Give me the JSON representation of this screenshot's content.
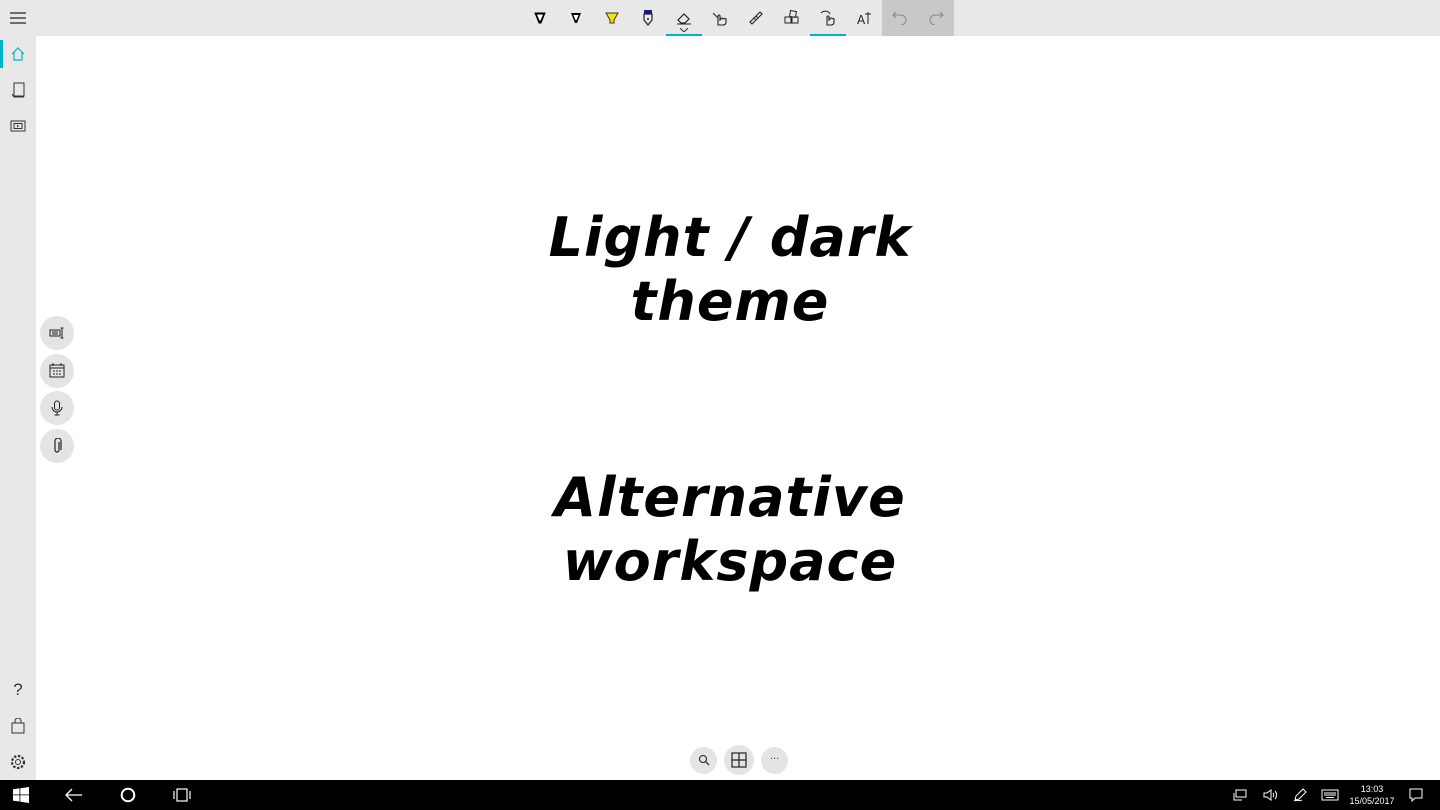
{
  "canvas": {
    "heading1": [
      "Light / dark",
      "theme"
    ],
    "heading2": [
      "Alternative",
      "workspace"
    ]
  },
  "toolbar": {
    "tools": [
      {
        "name": "ballpoint-pen-icon",
        "color": "#000000"
      },
      {
        "name": "pencil-tool-icon",
        "color": "#000000"
      },
      {
        "name": "highlighter-icon",
        "color": "#f2e600"
      },
      {
        "name": "fountain-pen-icon",
        "color": "#1a1a8c"
      },
      {
        "name": "eraser-icon",
        "active": true
      },
      {
        "name": "lasso-select-icon"
      },
      {
        "name": "ruler-icon"
      },
      {
        "name": "shapes-icon"
      },
      {
        "name": "touch-writing-icon",
        "active": true
      },
      {
        "name": "text-format-icon"
      },
      {
        "name": "undo-icon"
      },
      {
        "name": "redo-icon"
      }
    ]
  },
  "sidebar": {
    "items": [
      "home-icon",
      "notebook-icon",
      "presentation-icon",
      "help-icon",
      "store-icon",
      "settings-icon"
    ],
    "help_label": "?"
  },
  "float_tools": [
    "keyboard-text-icon",
    "calendar-icon",
    "microphone-icon",
    "attachment-icon"
  ],
  "bottom_controls": {
    "zoom": "search-icon",
    "grid": "grid-icon",
    "more_label": "···"
  },
  "taskbar": {
    "time": "13:03",
    "date": "15/05/2017"
  },
  "colors": {
    "accent": "#00b4c8",
    "chrome": "#e8e8e8",
    "taskbar": "#000000"
  }
}
